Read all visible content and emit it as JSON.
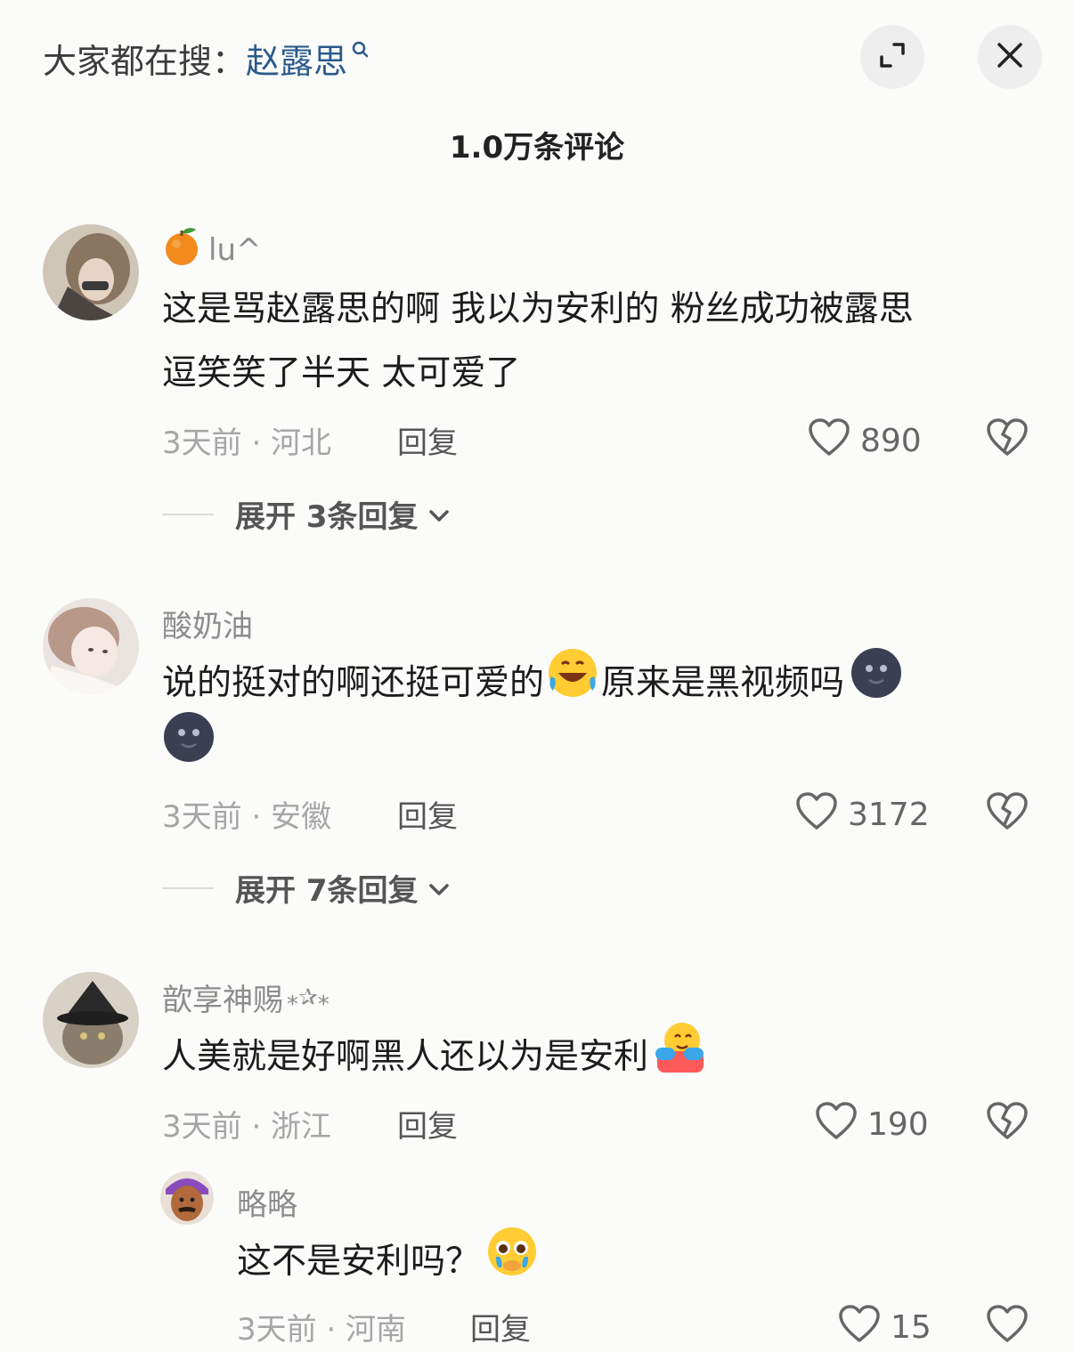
{
  "header": {
    "search_prefix": "大家都在搜：",
    "search_term": "赵露思",
    "expand_icon": "expand-icon",
    "close_icon": "close-icon"
  },
  "comment_count_title": "1.0万条评论",
  "comments": [
    {
      "username": "lu^",
      "username_emoji": "orange-emoji",
      "text_line1": "这是骂赵露思的啊 我以为安利的 粉丝成功被露思",
      "text_line2": "逗笑笑了半天 太可爱了",
      "meta": "3天前 · 河北",
      "reply_label": "回复",
      "likes": "890",
      "expand_label": "展开 3条回复"
    },
    {
      "username": "酸奶油",
      "text_part1": "说的挺对的啊还挺可爱的",
      "text_part2": "原来是黑视频吗",
      "meta": "3天前 · 安徽",
      "reply_label": "回复",
      "likes": "3172",
      "expand_label": "展开 7条回复"
    },
    {
      "username": "歆享神赐",
      "username_suffix": "⁎✰⁎",
      "text": "人美就是好啊黑人还以为是安利",
      "meta": "3天前 · 浙江",
      "reply_label": "回复",
      "likes": "190"
    }
  ],
  "reply": {
    "username": "略略",
    "text": "这不是安利吗？",
    "meta_partial": "3天前 · 河南",
    "reply_label": "回复",
    "likes_partial": "15"
  },
  "colors": {
    "background": "#fbfbfa",
    "search_term": "#2a5a8c",
    "muted_text": "#a6a6a6"
  }
}
